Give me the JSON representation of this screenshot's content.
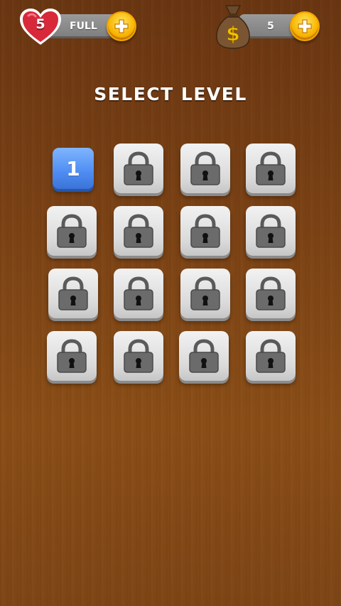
{
  "hud": {
    "lives": {
      "count": "5",
      "status": "FULL",
      "icon": "heart-icon",
      "color": "#d8293a"
    },
    "coins": {
      "count": "5",
      "icon": "money-bag-icon",
      "color": "#f2c200"
    },
    "add_icon": "plus-icon",
    "add_button_color": "#f7b400"
  },
  "title": "SELECT LEVEL",
  "levels": [
    {
      "label": "1",
      "locked": false,
      "color": "#4f8cf2"
    },
    {
      "label": "",
      "locked": true,
      "icon": "lock-icon"
    },
    {
      "label": "",
      "locked": true,
      "icon": "lock-icon"
    },
    {
      "label": "",
      "locked": true,
      "icon": "lock-icon"
    },
    {
      "label": "",
      "locked": true,
      "icon": "lock-icon"
    },
    {
      "label": "",
      "locked": true,
      "icon": "lock-icon"
    },
    {
      "label": "",
      "locked": true,
      "icon": "lock-icon"
    },
    {
      "label": "",
      "locked": true,
      "icon": "lock-icon"
    },
    {
      "label": "",
      "locked": true,
      "icon": "lock-icon"
    },
    {
      "label": "",
      "locked": true,
      "icon": "lock-icon"
    },
    {
      "label": "",
      "locked": true,
      "icon": "lock-icon"
    },
    {
      "label": "",
      "locked": true,
      "icon": "lock-icon"
    },
    {
      "label": "",
      "locked": true,
      "icon": "lock-icon"
    },
    {
      "label": "",
      "locked": true,
      "icon": "lock-icon"
    },
    {
      "label": "",
      "locked": true,
      "icon": "lock-icon"
    },
    {
      "label": "",
      "locked": true,
      "icon": "lock-icon"
    }
  ],
  "background_color": "#7a4114"
}
